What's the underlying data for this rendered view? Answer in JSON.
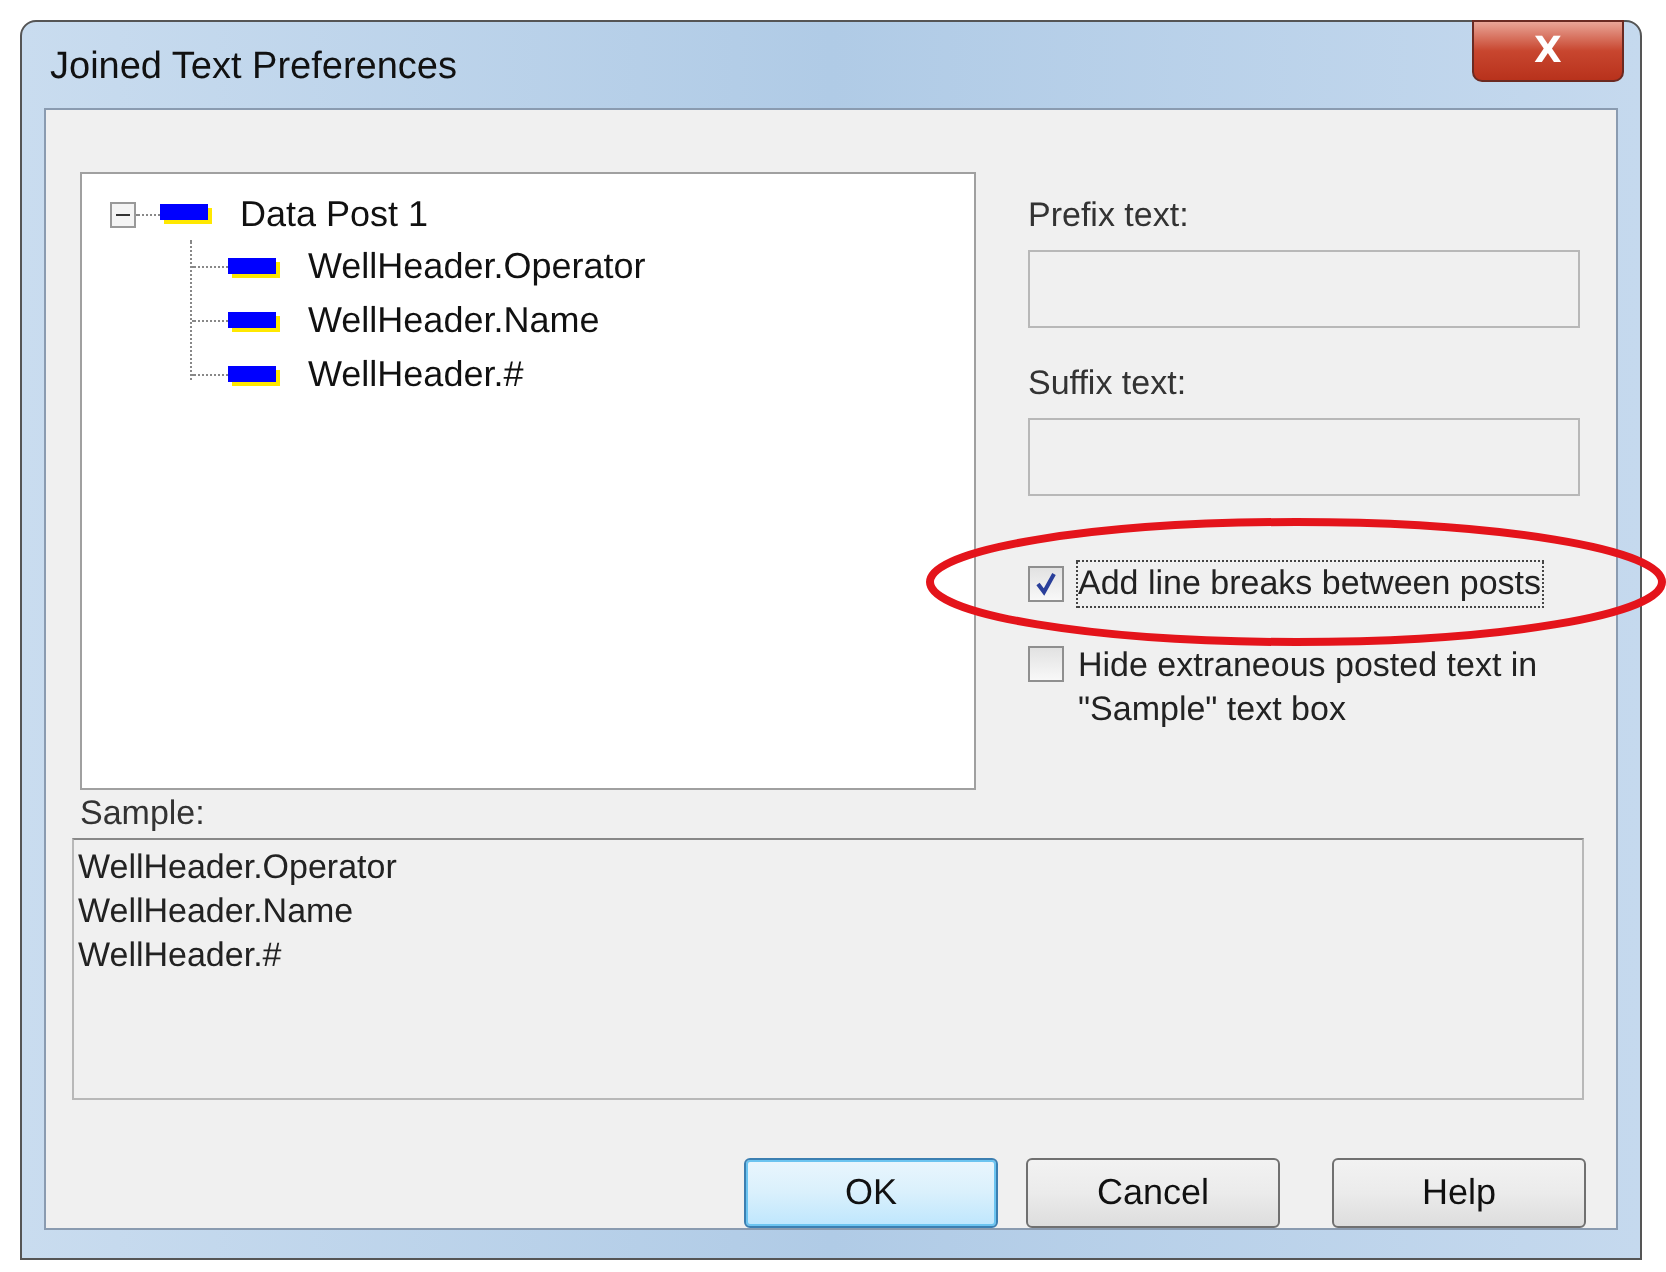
{
  "window": {
    "title": "Joined Text Preferences",
    "close": "X"
  },
  "tree": {
    "label": "Data Post 1",
    "expanded": true,
    "children": [
      {
        "label": "WellHeader.Operator"
      },
      {
        "label": "WellHeader.Name"
      },
      {
        "label": "WellHeader.#"
      }
    ]
  },
  "fields": [
    {
      "label": "Prefix text:"
    },
    {
      "label": "Suffix text:"
    }
  ],
  "checkboxes": [
    {
      "label": "Add line breaks between posts",
      "checked": true,
      "focused": true,
      "highlighted": true
    },
    {
      "label": "Hide extraneous posted text in \"Sample\" text box",
      "checked": false,
      "focused": false,
      "highlighted": false
    }
  ],
  "sample": {
    "label": "Sample:",
    "lines": [
      "WellHeader.Operator",
      "WellHeader.Name",
      "WellHeader.#"
    ]
  },
  "buttons": [
    {
      "label": "OK",
      "default": true
    },
    {
      "label": "Cancel",
      "default": false
    },
    {
      "label": "Help",
      "default": false
    }
  ]
}
